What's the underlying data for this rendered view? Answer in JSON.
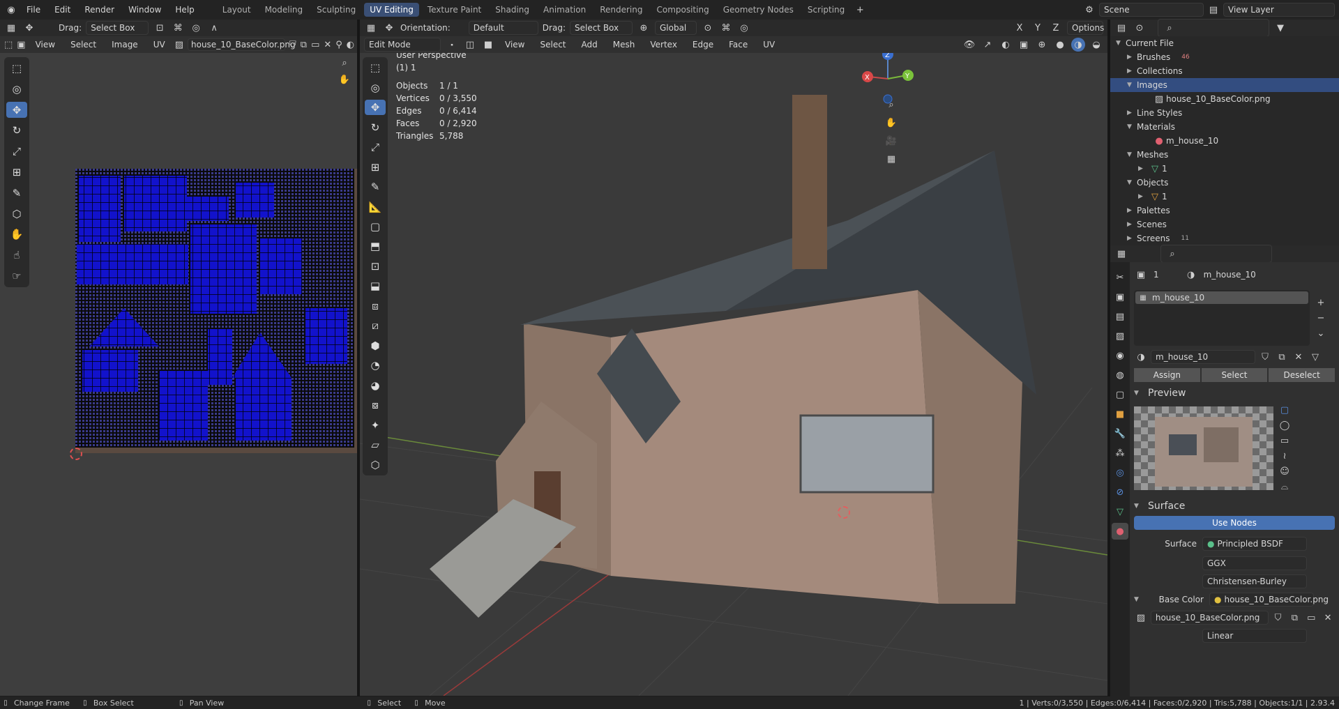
{
  "topbar": {
    "menus": [
      "File",
      "Edit",
      "Render",
      "Window",
      "Help"
    ],
    "workspaces": [
      "Layout",
      "Modeling",
      "Sculpting",
      "UV Editing",
      "Texture Paint",
      "Shading",
      "Animation",
      "Rendering",
      "Compositing",
      "Geometry Nodes",
      "Scripting"
    ],
    "active_workspace": "UV Editing",
    "scene": "Scene",
    "view_layer": "View Layer"
  },
  "uv_editor": {
    "drag_label": "Drag:",
    "drag_value": "Select Box",
    "menus": [
      "View",
      "Select",
      "Image",
      "UV"
    ],
    "image_name": "house_10_BaseColor.png"
  },
  "viewport": {
    "orientation_label": "Orientation:",
    "orientation_value": "Default",
    "drag_label": "Drag:",
    "drag_value": "Select Box",
    "transform": "Global",
    "options": "Options",
    "mode": "Edit Mode",
    "menus": [
      "View",
      "Select",
      "Add",
      "Mesh",
      "Vertex",
      "Edge",
      "Face",
      "UV"
    ],
    "overlay_title": "User Perspective",
    "overlay_sub": "(1) 1",
    "stats": [
      {
        "k": "Objects",
        "v": "1 / 1"
      },
      {
        "k": "Vertices",
        "v": "0 / 3,550"
      },
      {
        "k": "Edges",
        "v": "0 / 6,414"
      },
      {
        "k": "Faces",
        "v": "0 / 2,920"
      },
      {
        "k": "Triangles",
        "v": "5,788"
      }
    ],
    "gizmo": {
      "x": "X",
      "y": "Y",
      "z": "Z"
    }
  },
  "outliner": {
    "root": "Current File",
    "items": [
      {
        "label": "Brushes",
        "badge": "46"
      },
      {
        "label": "Collections",
        "badge": ""
      },
      {
        "label": "Images",
        "badge": ""
      },
      {
        "label": "house_10_BaseColor.png",
        "badge": ""
      },
      {
        "label": "Line Styles",
        "badge": ""
      },
      {
        "label": "Materials",
        "badge": ""
      },
      {
        "label": "m_house_10",
        "badge": ""
      },
      {
        "label": "Meshes",
        "badge": ""
      },
      {
        "label": "1",
        "badge": ""
      },
      {
        "label": "Objects",
        "badge": ""
      },
      {
        "label": "1",
        "badge": ""
      },
      {
        "label": "Palettes",
        "badge": ""
      },
      {
        "label": "Scenes",
        "badge": ""
      },
      {
        "label": "Screens",
        "badge": "11"
      }
    ]
  },
  "properties": {
    "object_count": "1",
    "material_name": "m_house_10",
    "slot_name": "m_house_10",
    "material_field": "m_house_10",
    "assign": "Assign",
    "select": "Select",
    "deselect": "Deselect",
    "preview_title": "Preview",
    "surface_title": "Surface",
    "use_nodes": "Use Nodes",
    "surface_label": "Surface",
    "surface_value": "Principled BSDF",
    "distribution": "GGX",
    "subsurface": "Christensen-Burley",
    "base_color_label": "Base Color",
    "base_color_value": "house_10_BaseColor.png",
    "image_field": "house_10_BaseColor.png",
    "colorspace": "Linear"
  },
  "statusbar": {
    "items": [
      "Change Frame",
      "Box Select",
      "Pan View",
      "Select",
      "Move"
    ],
    "stats": "1 | Verts:0/3,550 | Edges:0/6,414 | Faces:0/2,920 | Tris:5,788 | Objects:1/1 | 2.93.4"
  },
  "colors": {
    "accent": "#4772b3",
    "uv_island": "#1414d8",
    "selected_row": "#334d80"
  }
}
